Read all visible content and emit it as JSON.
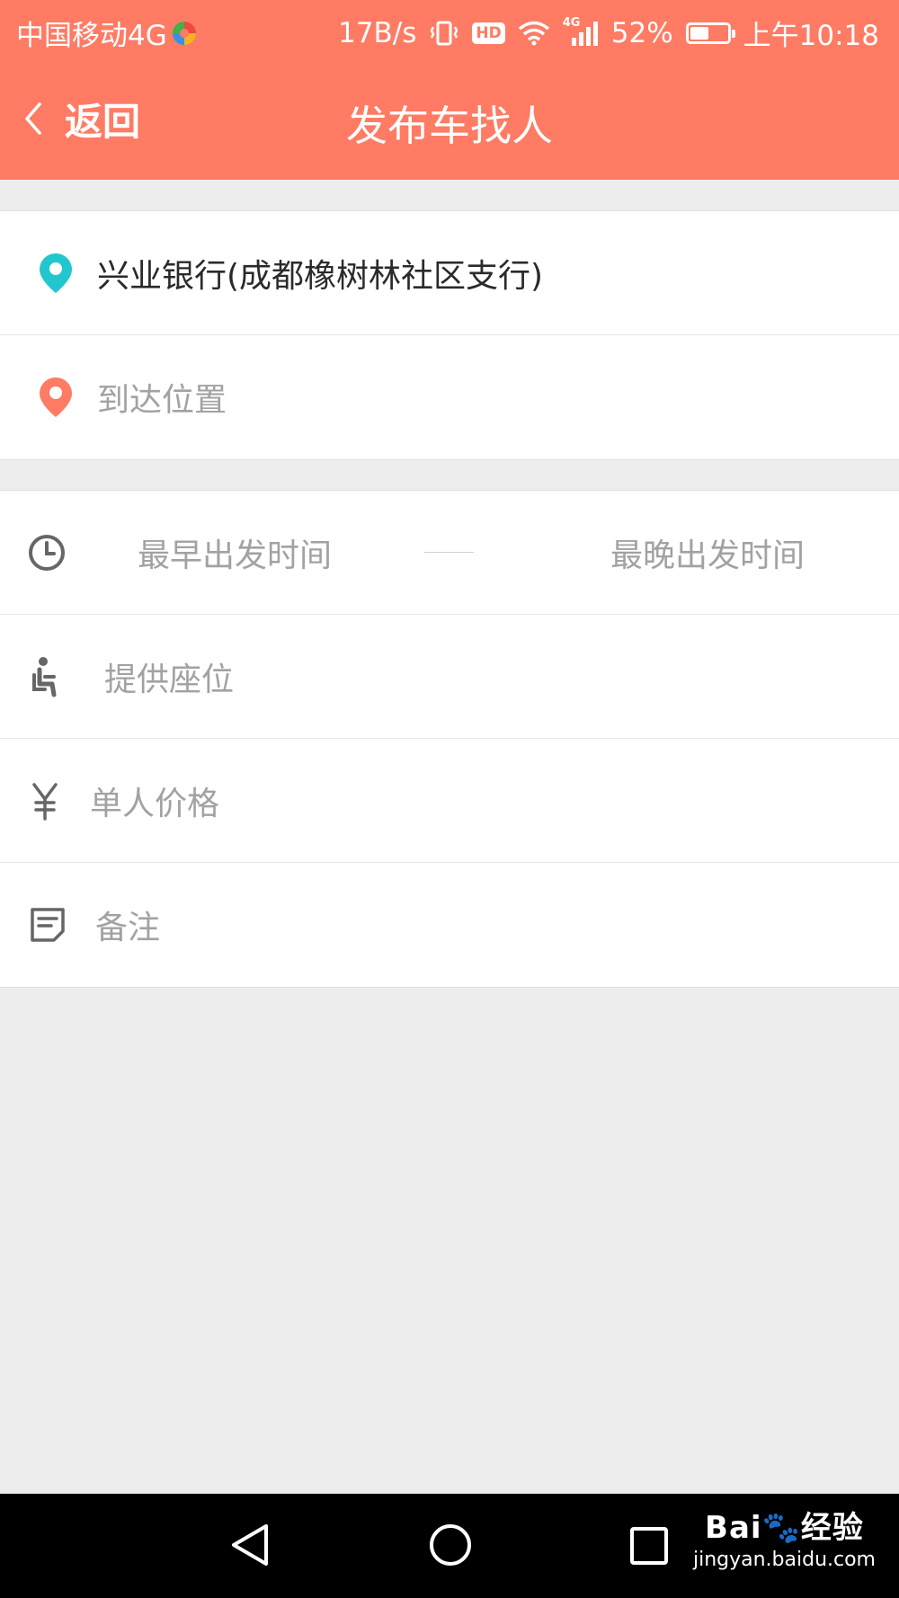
{
  "status_bar": {
    "carrier": "中国移动4G",
    "net_speed": "17B/s",
    "hd_badge": "HD",
    "signal_type": "4G",
    "battery": "52%",
    "battery_level": 0.52,
    "time": "上午10:18"
  },
  "header": {
    "back_label": "返回",
    "title": "发布车找人"
  },
  "route": {
    "start": "兴业银行(成都橡树林社区支行)",
    "destination_placeholder": "到达位置"
  },
  "details": {
    "earliest_time_placeholder": "最早出发时间",
    "latest_time_placeholder": "最晚出发时间",
    "seats_placeholder": "提供座位",
    "price_placeholder": "单人价格",
    "notes_placeholder": "备注"
  },
  "watermark": {
    "logo_left": "Bai",
    "logo_right": "经验",
    "url": "jingyan.baidu.com"
  },
  "colors": {
    "accent": "#ff7b64",
    "start_pin": "#21c7cc",
    "end_pin": "#ff7b64",
    "placeholder": "#a2a2a2"
  }
}
